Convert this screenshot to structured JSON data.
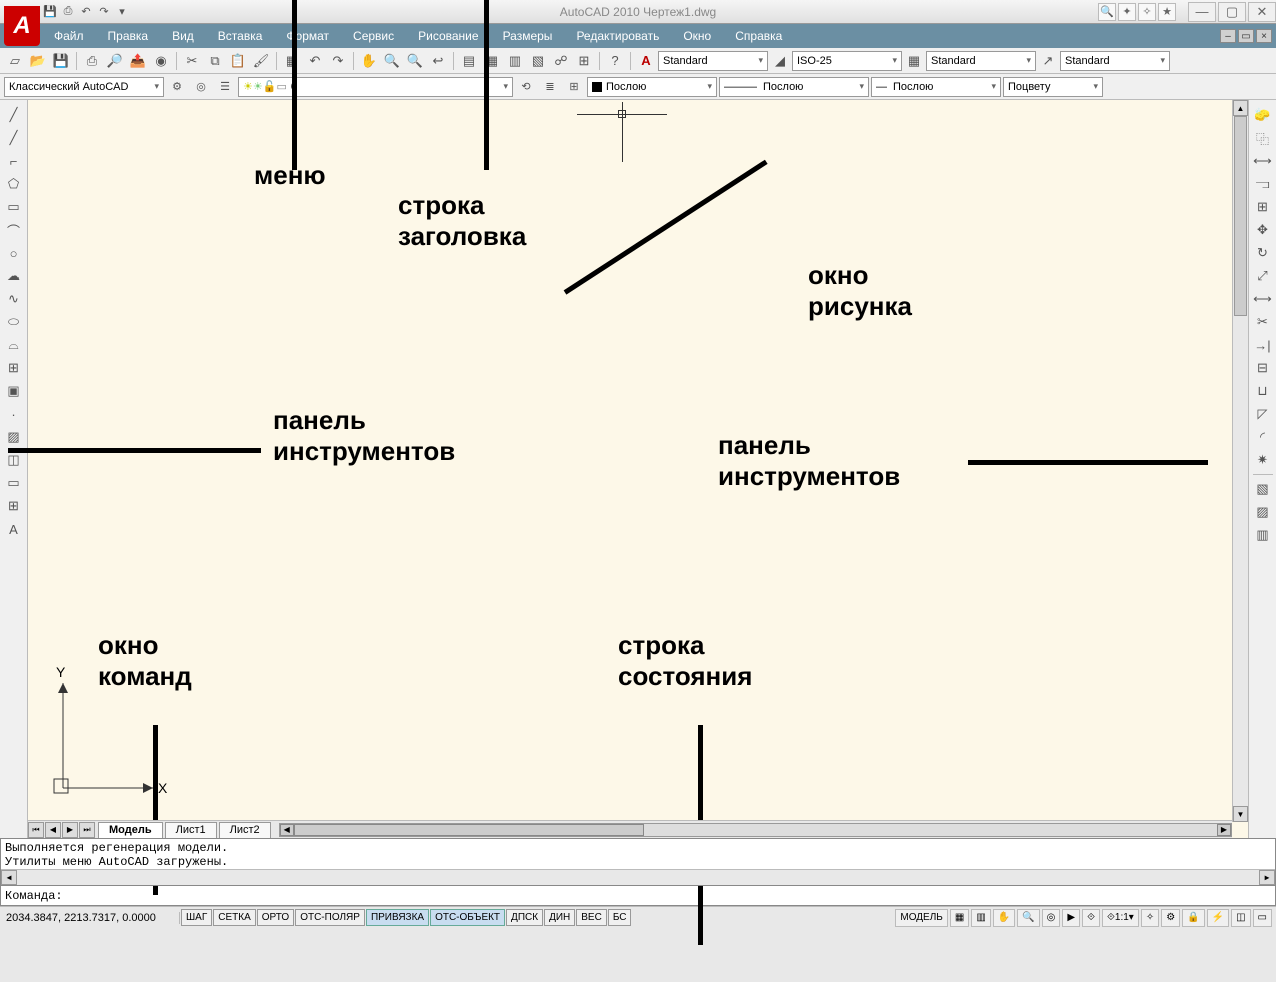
{
  "title_bar": {
    "app_title": "AutoCAD 2010 Чертеж1.dwg",
    "qat_icons": [
      "new",
      "open",
      "save",
      "undo",
      "redo",
      "print",
      "more"
    ]
  },
  "menu": {
    "items": [
      "Файл",
      "Правка",
      "Вид",
      "Вставка",
      "Формат",
      "Сервис",
      "Рисование",
      "Размеры",
      "Редактировать",
      "Окно",
      "Справка"
    ]
  },
  "toolbar1": {
    "style_text": "Standard",
    "dim_style": "ISO-25",
    "table_style": "Standard",
    "mleader_style": "Standard"
  },
  "toolbar2": {
    "workspace": "Классический AutoCAD",
    "layer": "0",
    "linetype": "Послою",
    "lineweight1": "Послою",
    "lineweight2": "Послою",
    "plotstyle": "Поцвету"
  },
  "annotations": {
    "menu": "меню",
    "title_row": "строка\nзаголовка",
    "drawing_window": "окно\nрисунка",
    "toolbar_left": "панель\nинструментов",
    "toolbar_right": "панель\nинструментов",
    "command_window": "окно\nкоманд",
    "status_row": "строка\nсостояния"
  },
  "ucs": {
    "x": "X",
    "y": "Y"
  },
  "tabs": {
    "model": "Модель",
    "sheet1": "Лист1",
    "sheet2": "Лист2"
  },
  "command": {
    "line1": "Выполняется регенерация модели.",
    "line2": "Утилиты меню AutoCAD загружены.",
    "prompt": "Команда:"
  },
  "status": {
    "coords": "2034.3847, 2213.7317, 0.0000",
    "toggles": [
      "ШАГ",
      "СЕТКА",
      "ОРТО",
      "ОТС-ПОЛЯР",
      "ПРИВЯЗКА",
      "ОТС-ОБЪЕКТ",
      "ДПСК",
      "ДИН",
      "ВЕС",
      "БС"
    ],
    "active_toggles": [
      "ПРИВЯЗКА",
      "ОТС-ОБЪЕКТ"
    ],
    "model_label": "МОДЕЛЬ",
    "scale": "1:1"
  }
}
